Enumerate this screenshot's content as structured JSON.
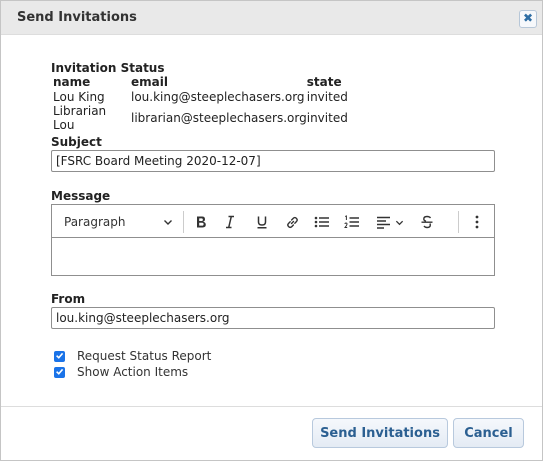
{
  "dialog": {
    "title": "Send Invitations",
    "close_icon": "close-icon"
  },
  "status": {
    "title": "Invitation Status",
    "columns": [
      "name",
      "email",
      "state"
    ],
    "rows": [
      {
        "name": "Lou King",
        "email": "lou.king@steeplechasers.org",
        "state": "invited"
      },
      {
        "name": "Librarian Lou",
        "email": "librarian@steeplechasers.org",
        "state": "invited"
      }
    ]
  },
  "subject": {
    "label": "Subject",
    "value": "[FSRC Board Meeting 2020-12-07]"
  },
  "message": {
    "label": "Message",
    "toolbar": {
      "paragraph_label": "Paragraph",
      "icons": [
        "bold-icon",
        "italic-icon",
        "underline-icon",
        "link-icon",
        "bulleted-list-icon",
        "numbered-list-icon",
        "align-icon",
        "strikethrough-icon",
        "more-icon"
      ]
    },
    "body": ""
  },
  "from": {
    "label": "From",
    "value": "lou.king@steeplechasers.org"
  },
  "options": [
    {
      "label": "Request Status Report",
      "checked": true
    },
    {
      "label": "Show Action Items",
      "checked": true
    }
  ],
  "buttons": {
    "send": "Send Invitations",
    "cancel": "Cancel"
  },
  "colors": {
    "accent": "#1a73e8",
    "button_text": "#2b5f91"
  }
}
